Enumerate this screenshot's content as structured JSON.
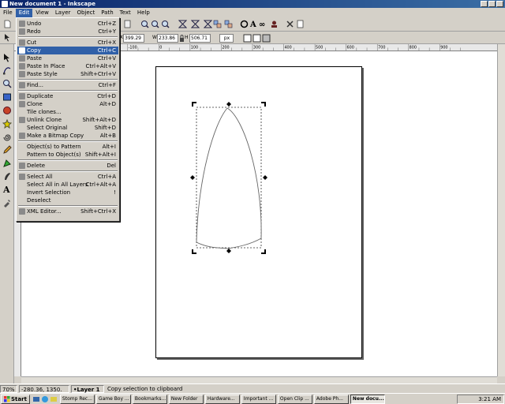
{
  "window": {
    "title": "New document 1 - Inkscape"
  },
  "menu": [
    "File",
    "Edit",
    "View",
    "Layer",
    "Object",
    "Path",
    "Text",
    "Help"
  ],
  "ctrlbar": {
    "x_label": "X",
    "x": "399.29",
    "w_label": "W",
    "w": "233.86",
    "h_label": "H",
    "h": "506.71",
    "unit": "px"
  },
  "ruler_ticks": [
    "-100",
    "0",
    "100",
    "200",
    "300",
    "400",
    "500",
    "600",
    "700",
    "800",
    "900",
    "1000",
    "1100",
    "1200"
  ],
  "edit_menu": [
    {
      "label": "Undo",
      "shortcut": "Ctrl+Z",
      "icon": "undo-icon"
    },
    {
      "label": "Redo",
      "shortcut": "Ctrl+Y",
      "icon": "redo-icon"
    },
    {
      "sep": true
    },
    {
      "label": "Cut",
      "shortcut": "Ctrl+X",
      "icon": "cut-icon"
    },
    {
      "label": "Copy",
      "shortcut": "Ctrl+C",
      "icon": "copy-icon",
      "highlight": true
    },
    {
      "label": "Paste",
      "shortcut": "Ctrl+V",
      "icon": "paste-icon"
    },
    {
      "label": "Paste In Place",
      "shortcut": "Ctrl+Alt+V",
      "icon": "paste-in-place-icon"
    },
    {
      "label": "Paste Style",
      "shortcut": "Shift+Ctrl+V",
      "icon": "paste-style-icon"
    },
    {
      "sep": true
    },
    {
      "label": "Find...",
      "shortcut": "Ctrl+F",
      "icon": "find-icon"
    },
    {
      "sep": true
    },
    {
      "label": "Duplicate",
      "shortcut": "Ctrl+D",
      "icon": "duplicate-icon"
    },
    {
      "label": "Clone",
      "shortcut": "Alt+D",
      "icon": "clone-icon"
    },
    {
      "label": "Tile clones...",
      "shortcut": "",
      "icon": ""
    },
    {
      "label": "Unlink Clone",
      "shortcut": "Shift+Alt+D",
      "icon": "unlink-clone-icon"
    },
    {
      "label": "Select Original",
      "shortcut": "Shift+D",
      "icon": ""
    },
    {
      "label": "Make a Bitmap Copy",
      "shortcut": "Alt+B",
      "icon": "bitmap-copy-icon"
    },
    {
      "sep": true
    },
    {
      "label": "Object(s) to Pattern",
      "shortcut": "Alt+I",
      "icon": ""
    },
    {
      "label": "Pattern to Object(s)",
      "shortcut": "Shift+Alt+I",
      "icon": ""
    },
    {
      "sep": true
    },
    {
      "label": "Delete",
      "shortcut": "Del",
      "icon": "delete-icon"
    },
    {
      "sep": true
    },
    {
      "label": "Select All",
      "shortcut": "Ctrl+A",
      "icon": "select-all-icon"
    },
    {
      "label": "Select All in All Layers",
      "shortcut": "Ctrl+Alt+A",
      "icon": ""
    },
    {
      "label": "Invert Selection",
      "shortcut": "!",
      "icon": ""
    },
    {
      "label": "Deselect",
      "shortcut": "",
      "icon": ""
    },
    {
      "sep": true
    },
    {
      "label": "XML Editor...",
      "shortcut": "Shift+Ctrl+X",
      "icon": "xml-editor-icon"
    }
  ],
  "status": {
    "zoom": "70%",
    "coords": "-280.36, 1350.",
    "layer": "•Layer 1",
    "message": "Copy selection to clipboard"
  },
  "taskbar": {
    "start": "Start",
    "tasks": [
      "Stomp Rec...",
      "Game Boy ...",
      "Bookmarks...",
      "New Folder",
      "Hardware...",
      "Important ...",
      "Open Clip ...",
      "Adobe Ph...",
      "New docu..."
    ],
    "active_task": 8,
    "time": "3:21 AM"
  }
}
